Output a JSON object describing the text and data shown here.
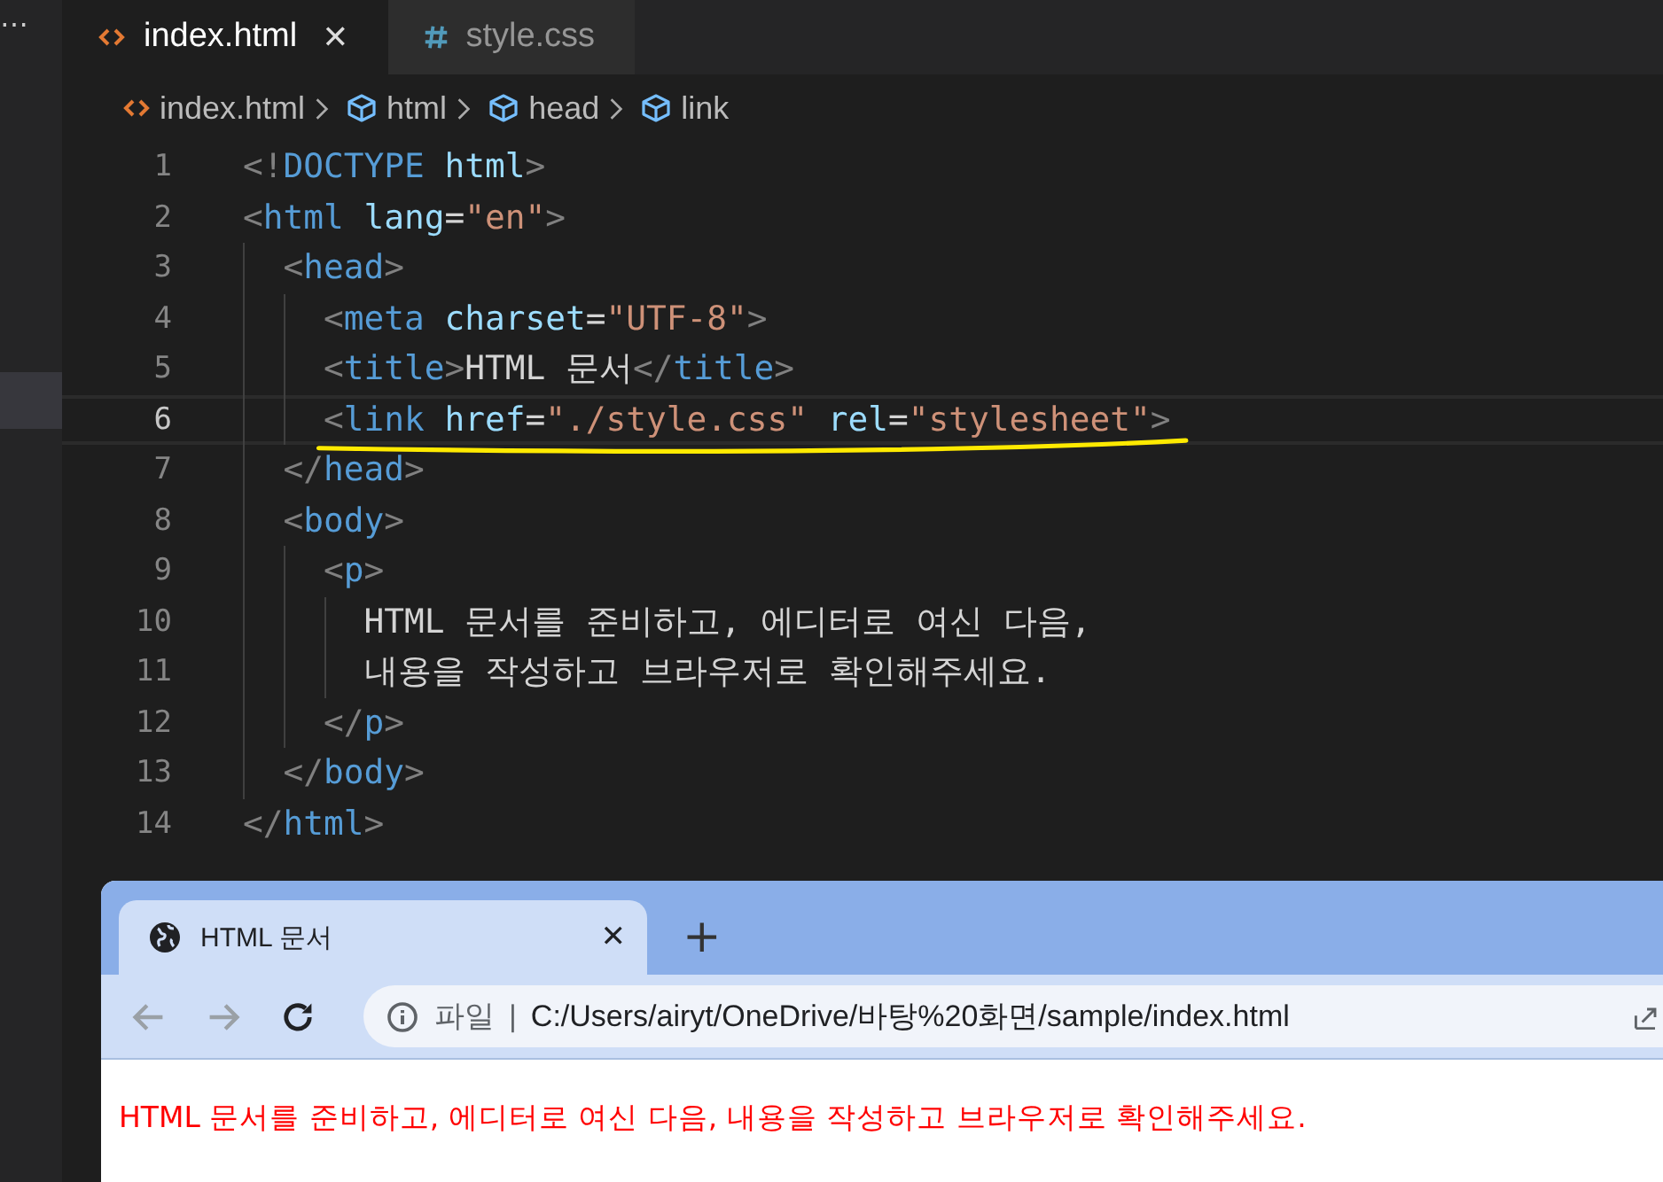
{
  "activity_bar": {
    "more": "⋯"
  },
  "tabs": [
    {
      "label": "index.html",
      "kind": "html",
      "selected": true,
      "close": "✕"
    },
    {
      "label": "style.css",
      "kind": "css",
      "selected": false
    }
  ],
  "breadcrumbs": [
    {
      "label": "index.html",
      "kind": "file"
    },
    {
      "label": "html",
      "kind": "element"
    },
    {
      "label": "head",
      "kind": "element"
    },
    {
      "label": "link",
      "kind": "element"
    }
  ],
  "lines": [
    {
      "number": "1",
      "selected": false,
      "underlined": false,
      "tokens": [
        {
          "kind": "punct",
          "text": "<!"
        },
        {
          "kind": "tag",
          "text": "DOCTYPE"
        },
        {
          "kind": "attr",
          "text": " html"
        },
        {
          "kind": "punct",
          "text": ">"
        }
      ]
    },
    {
      "number": "2",
      "selected": false,
      "underlined": false,
      "tokens": [
        {
          "kind": "punct",
          "text": "<"
        },
        {
          "kind": "tag",
          "text": "html"
        },
        {
          "kind": "attr",
          "text": " lang"
        },
        {
          "kind": "plain",
          "text": "="
        },
        {
          "kind": "str",
          "text": "\"en\""
        },
        {
          "kind": "punct",
          "text": ">"
        }
      ],
      "children": [
        {
          "number": "3",
          "selected": false,
          "underlined": false,
          "tokens": [
            {
              "kind": "punct",
              "text": "<"
            },
            {
              "kind": "tag",
              "text": "head"
            },
            {
              "kind": "punct",
              "text": ">"
            }
          ],
          "children": [
            {
              "number": "4",
              "selected": false,
              "underlined": false,
              "tokens": [
                {
                  "kind": "punct",
                  "text": "<"
                },
                {
                  "kind": "tag",
                  "text": "meta"
                },
                {
                  "kind": "attr",
                  "text": " charset"
                },
                {
                  "kind": "plain",
                  "text": "="
                },
                {
                  "kind": "str",
                  "text": "\"UTF-8\""
                },
                {
                  "kind": "punct",
                  "text": ">"
                }
              ]
            },
            {
              "number": "5",
              "selected": false,
              "underlined": false,
              "tokens": [
                {
                  "kind": "punct",
                  "text": "<"
                },
                {
                  "kind": "tag",
                  "text": "title"
                },
                {
                  "kind": "punct",
                  "text": ">"
                },
                {
                  "kind": "plain",
                  "text": "HTML 문서"
                },
                {
                  "kind": "punct",
                  "text": "</"
                },
                {
                  "kind": "tag",
                  "text": "title"
                },
                {
                  "kind": "punct",
                  "text": ">"
                }
              ]
            },
            {
              "number": "6",
              "selected": true,
              "underlined": true,
              "tokens": [
                {
                  "kind": "punct",
                  "text": "<"
                },
                {
                  "kind": "tag",
                  "text": "link"
                },
                {
                  "kind": "attr",
                  "text": " href"
                },
                {
                  "kind": "plain",
                  "text": "="
                },
                {
                  "kind": "str",
                  "text": "\"./style.css\""
                },
                {
                  "kind": "attr",
                  "text": " rel"
                },
                {
                  "kind": "plain",
                  "text": "="
                },
                {
                  "kind": "str",
                  "text": "\"stylesheet\""
                },
                {
                  "kind": "punct",
                  "text": ">"
                }
              ]
            }
          ]
        },
        {
          "number": "7",
          "selected": false,
          "underlined": false,
          "tokens": [
            {
              "kind": "punct",
              "text": "</"
            },
            {
              "kind": "tag",
              "text": "head"
            },
            {
              "kind": "punct",
              "text": ">"
            }
          ]
        },
        {
          "number": "8",
          "selected": false,
          "underlined": false,
          "tokens": [
            {
              "kind": "punct",
              "text": "<"
            },
            {
              "kind": "tag",
              "text": "body"
            },
            {
              "kind": "punct",
              "text": ">"
            }
          ],
          "children": [
            {
              "number": "9",
              "selected": false,
              "underlined": false,
              "tokens": [
                {
                  "kind": "punct",
                  "text": "<"
                },
                {
                  "kind": "tag",
                  "text": "p"
                },
                {
                  "kind": "punct",
                  "text": ">"
                }
              ],
              "children": [
                {
                  "number": "10",
                  "selected": false,
                  "underlined": false,
                  "tokens": [
                    {
                      "kind": "plain",
                      "text": "HTML 문서를 준비하고, 에디터로 여신 다음,"
                    }
                  ]
                },
                {
                  "number": "11",
                  "selected": false,
                  "underlined": false,
                  "tokens": [
                    {
                      "kind": "plain",
                      "text": "내용을 작성하고 브라우저로 확인해주세요."
                    }
                  ]
                }
              ]
            },
            {
              "number": "12",
              "selected": false,
              "underlined": false,
              "tokens": [
                {
                  "kind": "punct",
                  "text": "</"
                },
                {
                  "kind": "tag",
                  "text": "p"
                },
                {
                  "kind": "punct",
                  "text": ">"
                }
              ]
            }
          ]
        },
        {
          "number": "13",
          "selected": false,
          "underlined": false,
          "tokens": [
            {
              "kind": "punct",
              "text": "</"
            },
            {
              "kind": "tag",
              "text": "body"
            },
            {
              "kind": "punct",
              "text": ">"
            }
          ]
        }
      ]
    },
    {
      "number": "14",
      "selected": false,
      "underlined": false,
      "tokens": [
        {
          "kind": "punct",
          "text": "</"
        },
        {
          "kind": "tag",
          "text": "html"
        },
        {
          "kind": "punct",
          "text": ">"
        }
      ]
    }
  ],
  "browser": {
    "tab": {
      "title": "HTML 문서",
      "close": "✕"
    },
    "new_tab": "+",
    "address": {
      "scheme": "파일",
      "separator": "|",
      "url": "C:/Users/airyt/OneDrive/바탕%20화면/sample/index.html"
    },
    "content": {
      "text": "HTML 문서를 준비하고, 에디터로 여신 다음, 내용을 작성하고 브라우저로 확인해주세요."
    }
  }
}
